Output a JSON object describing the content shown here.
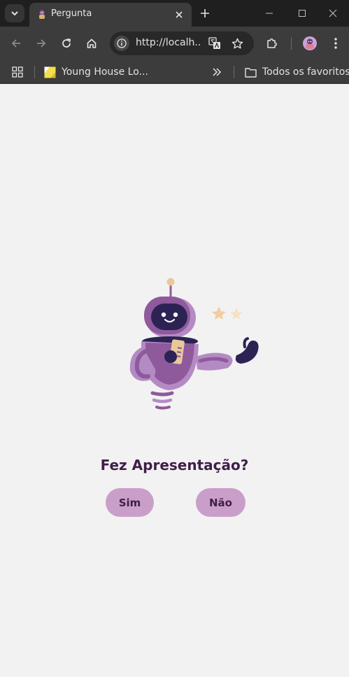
{
  "browser": {
    "tab": {
      "title": "Pergunta"
    },
    "omnibox": {
      "url": "http://localh..."
    },
    "bookmarks": {
      "items": [
        {
          "label": "Young House Lo..."
        }
      ],
      "all_bookmarks_label": "Todos os favoritos"
    }
  },
  "page": {
    "question": "Fez Apresentação?",
    "buttons": {
      "yes_label": "Sim",
      "no_label": "Não"
    },
    "colors": {
      "background": "#f2f2f2",
      "button": "#c99fc9",
      "text": "#3f1e48",
      "robot": "#8e5a9c"
    }
  }
}
